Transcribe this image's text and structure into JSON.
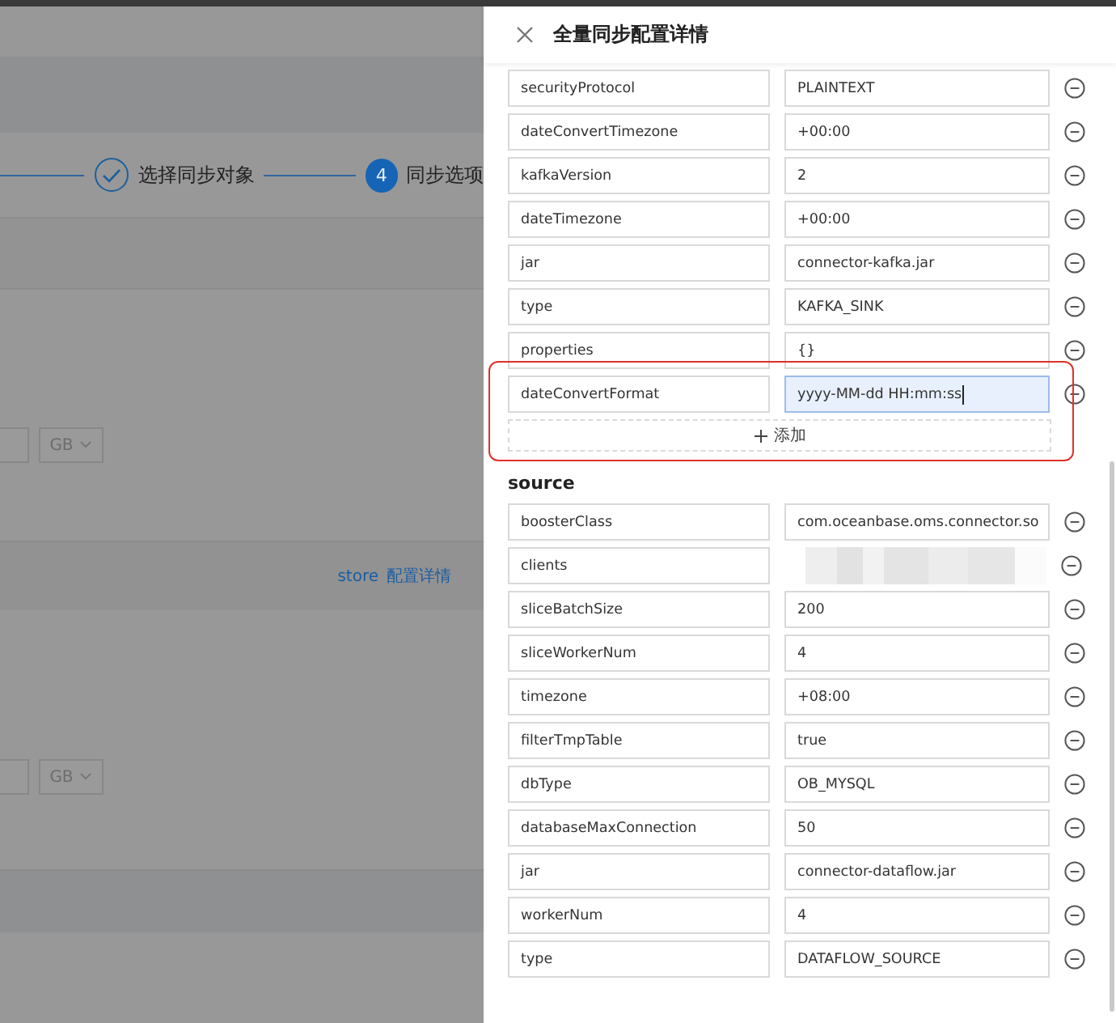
{
  "background": {
    "steps": [
      {
        "label": "选择同步对象",
        "done": true
      },
      {
        "label": "同步选项",
        "done": false,
        "number": "4"
      }
    ],
    "unit_selects": [
      "GB",
      "GB"
    ],
    "links": [
      "store",
      "配置详情"
    ]
  },
  "drawer": {
    "title": "全量同步配置详情",
    "sink_rows": [
      {
        "key": "securityProtocol",
        "value": "PLAINTEXT",
        "focused": false
      },
      {
        "key": "dateConvertTimezone",
        "value": "+00:00",
        "focused": false
      },
      {
        "key": "kafkaVersion",
        "value": "2",
        "focused": false
      },
      {
        "key": "dateTimezone",
        "value": "+00:00",
        "focused": false
      },
      {
        "key": "jar",
        "value": "connector-kafka.jar",
        "focused": false
      },
      {
        "key": "type",
        "value": "KAFKA_SINK",
        "focused": false
      },
      {
        "key": "properties",
        "value": "{}",
        "focused": false
      },
      {
        "key": "dateConvertFormat",
        "value": "yyyy-MM-dd HH:mm:ss",
        "focused": true,
        "highlighted": true
      }
    ],
    "add_button": "添加",
    "source_title": "source",
    "source_rows": [
      {
        "key": "boosterClass",
        "value": "com.oceanbase.oms.connector.so"
      },
      {
        "key": "clients",
        "redacted": true
      },
      {
        "key": "sliceBatchSize",
        "value": "200"
      },
      {
        "key": "sliceWorkerNum",
        "value": "4"
      },
      {
        "key": "timezone",
        "value": "+08:00"
      },
      {
        "key": "filterTmpTable",
        "value": "true"
      },
      {
        "key": "dbType",
        "value": "OB_MYSQL"
      },
      {
        "key": "databaseMaxConnection",
        "value": "50"
      },
      {
        "key": "jar",
        "value": "connector-dataflow.jar"
      },
      {
        "key": "workerNum",
        "value": "4"
      },
      {
        "key": "type",
        "value": "DATAFLOW_SOURCE"
      }
    ]
  }
}
